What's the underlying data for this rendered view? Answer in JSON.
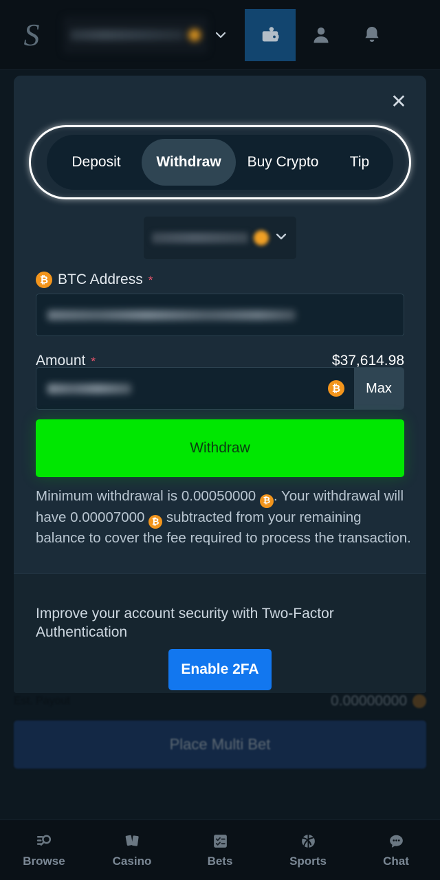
{
  "header": {
    "logo": "S",
    "balance_value": "",
    "chevron": "⌄",
    "wallet_icon": "wallet-icon",
    "profile_icon": "person-icon",
    "notifications_icon": "bell-icon"
  },
  "modal": {
    "close_label": "✕",
    "tabs": [
      {
        "label": "Deposit",
        "active": false
      },
      {
        "label": "Withdraw",
        "active": true
      },
      {
        "label": "Buy Crypto",
        "active": false
      },
      {
        "label": "Tip",
        "active": false
      }
    ],
    "currency_select": {
      "value": "",
      "chevron": "⌄"
    },
    "address_field": {
      "label": "BTC Address",
      "required_marker": "*",
      "coin_symbol": "₿",
      "value": ""
    },
    "amount_field": {
      "label": "Amount",
      "required_marker": "*",
      "balance_usd": "$37,614.98",
      "value": "",
      "coin_symbol": "₿",
      "max_label": "Max"
    },
    "submit_label": "Withdraw",
    "note": {
      "part1": "Minimum withdrawal is 0.00050000",
      "coin1": "₿",
      "part2": ". Your withdrawal will have 0.00007000",
      "coin2": "₿",
      "part3": " subtracted from your remaining balance to cover the fee required to process the transaction.",
      "minimum_withdrawal": "0.00050000",
      "fee": "0.00007000"
    },
    "twofa": {
      "text": "Improve your account security with Two-Factor Authentication",
      "button_label": "Enable 2FA"
    }
  },
  "background_page": {
    "payout_label": "Est. Payout",
    "payout_value": "0.00000000",
    "place_bet_label": "Place Multi Bet"
  },
  "bottom_nav": [
    {
      "label": "Browse",
      "icon": "browse-search-icon"
    },
    {
      "label": "Casino",
      "icon": "cards-icon"
    },
    {
      "label": "Bets",
      "icon": "checklist-icon"
    },
    {
      "label": "Sports",
      "icon": "basketball-icon"
    },
    {
      "label": "Chat",
      "icon": "chat-bubble-icon"
    }
  ],
  "colors": {
    "modal_bg": "#1b2c39",
    "page_bg": "#0a1117",
    "accent_green": "#00e701",
    "accent_blue": "#1277ef",
    "bitcoin_orange": "#f3951c",
    "tab_active": "#2f4553",
    "required_red": "#e9546b"
  }
}
